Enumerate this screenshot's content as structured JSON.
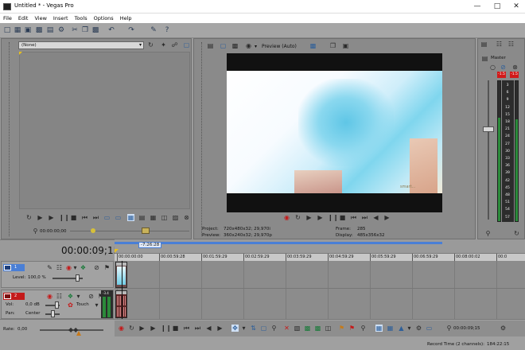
{
  "window": {
    "title": "Untitled * - Vegas Pro"
  },
  "menu": [
    "File",
    "Edit",
    "View",
    "Insert",
    "Tools",
    "Options",
    "Help"
  ],
  "explorer": {
    "dropdown": "(None)"
  },
  "preview": {
    "mode": "Preview (Auto)",
    "project_label": "Project:",
    "project_value": "720x480x32; 29,970i",
    "preview_label": "Preview:",
    "preview_value": "360x240x32; 29,970p",
    "frame_label": "Frame:",
    "frame_value": "285",
    "display_label": "Display:",
    "display_value": "485x356x32",
    "watermark": "smart..."
  },
  "trimmer": {
    "timecode": "00:00:00;00"
  },
  "master": {
    "label": "Master",
    "peak_left": "-1.5",
    "peak_right": "-1.5",
    "scale": [
      "3",
      "6",
      "9",
      "12",
      "15",
      "18",
      "21",
      "24",
      "27",
      "30",
      "33",
      "36",
      "39",
      "42",
      "45",
      "48",
      "51",
      "54",
      "57"
    ]
  },
  "timeline": {
    "timecode": "00:00:09;15",
    "loop_label": "-7:26:28",
    "ruler": [
      "00:00:00:00",
      "00:00:59:28",
      "00:01:59:29",
      "00:02:59:29",
      "00:03:59:29",
      "00:04:59:29",
      "00:05:59:29",
      "00:06:59:29",
      "00:08:00:02",
      "00:0"
    ],
    "video_track": {
      "number": "1",
      "level_label": "Level:",
      "level_value": "100,0 %"
    },
    "audio_track": {
      "number": "2",
      "vol_label": "Vol:",
      "vol_value": "0,0 dB",
      "touch": "Touch",
      "pan_label": "Pan:",
      "pan_value": "Center",
      "meter_value": "-3.4",
      "meter_ticks": [
        "12",
        "24",
        "36",
        "48"
      ]
    },
    "rate_label": "Rate:",
    "rate_value": "0,00",
    "cursor_time": "00:00:09;15",
    "record_time": "Record Time (2 channels):",
    "record_value": "184:22:15"
  },
  "colors": {
    "loop_bar": "#4a7fd6",
    "peak_red": "#d11a1a",
    "meter_green": "#2b8a3a"
  }
}
